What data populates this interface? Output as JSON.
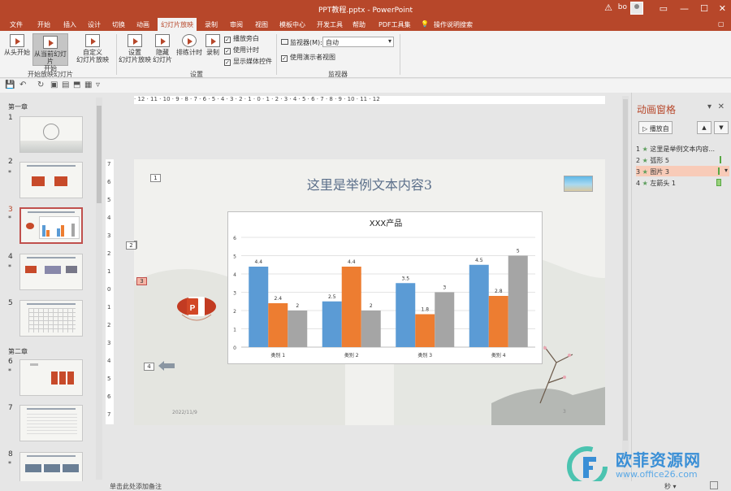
{
  "titlebar": {
    "title": "PPT教程.pptx - PowerPoint",
    "user": "bo",
    "warn": "⚠",
    "min": "—",
    "max": "☐",
    "close": "✕"
  },
  "menu": [
    "文件",
    "开始",
    "插入",
    "设计",
    "切换",
    "动画",
    "幻灯片放映",
    "录制",
    "审阅",
    "视图",
    "模板中心",
    "开发工具",
    "帮助",
    "PDF工具集",
    "操作说明搜索"
  ],
  "ribbon": {
    "from_start": "从头开始",
    "from_current_1": "从当前幻灯片",
    "from_current_2": "开始",
    "custom_1": "自定义",
    "custom_2": "幻灯片放映",
    "setup_1": "设置",
    "setup_2": "幻灯片放映",
    "hide_1": "隐藏",
    "hide_2": "幻灯片",
    "rehearse": "排练计时",
    "record": "录制",
    "play_narration": "播放旁白",
    "use_timings": "使用计时",
    "show_media": "显示媒体控件",
    "monitor_label": "监视器(M):",
    "monitor_value": "自动",
    "presenter_view": "使用演示者视图",
    "group_start": "开始放映幻灯片",
    "group_setup": "设置",
    "group_monitor": "监视器"
  },
  "thumbs": {
    "section1": "第一章",
    "section2": "第二章",
    "nums": [
      "1",
      "2",
      "3",
      "4",
      "5",
      "6",
      "7",
      "8"
    ],
    "star": "*"
  },
  "ruler_h": "· 12 · 11 · 10 · 9 · 8 · 7 · 6 · 5 · 4 · 3 · 2 · 1 · 0 · 1 · 2 · 3 · 4 · 5 · 6 · 7 · 8 · 9 · 10 · 11 · 12",
  "ruler_v": [
    "7",
    "6",
    "5",
    "4",
    "3",
    "2",
    "1",
    "0",
    "1",
    "2",
    "3",
    "4",
    "5",
    "6",
    "7"
  ],
  "slide": {
    "title": "这里是举例文本内容3",
    "date": "2022/11/9",
    "page": "3",
    "tags": [
      "1",
      "2",
      "3",
      "4"
    ]
  },
  "chart_data": {
    "type": "bar",
    "title": "XXX产品",
    "categories": [
      "类别 1",
      "类别 2",
      "类别 3",
      "类别 4"
    ],
    "series": [
      {
        "values": [
          4.4,
          2.5,
          3.5,
          4.5
        ],
        "color": "#5b9bd5"
      },
      {
        "values": [
          2.4,
          4.4,
          1.8,
          2.8
        ],
        "color": "#ed7d31"
      },
      {
        "values": [
          2,
          2,
          3,
          5
        ],
        "color": "#a5a5a5"
      }
    ],
    "ylim": [
      0,
      6
    ],
    "yticks": [
      "0",
      "1",
      "2",
      "3",
      "4",
      "5",
      "6"
    ],
    "grid": true
  },
  "animpane": {
    "title": "动画窗格",
    "close": "✕",
    "play": "播放自",
    "items": [
      {
        "num": "1",
        "label": "这里是举例文本内容..."
      },
      {
        "num": "2",
        "label": "弧形 5"
      },
      {
        "num": "3",
        "label": "图片 3"
      },
      {
        "num": "4",
        "label": "左箭头 1"
      }
    ]
  },
  "status": {
    "notes": "单击此处添加备注",
    "seconds": "秒 ▾"
  },
  "watermark": {
    "cn": "欧菲资源网",
    "en": "www.office26.com"
  }
}
